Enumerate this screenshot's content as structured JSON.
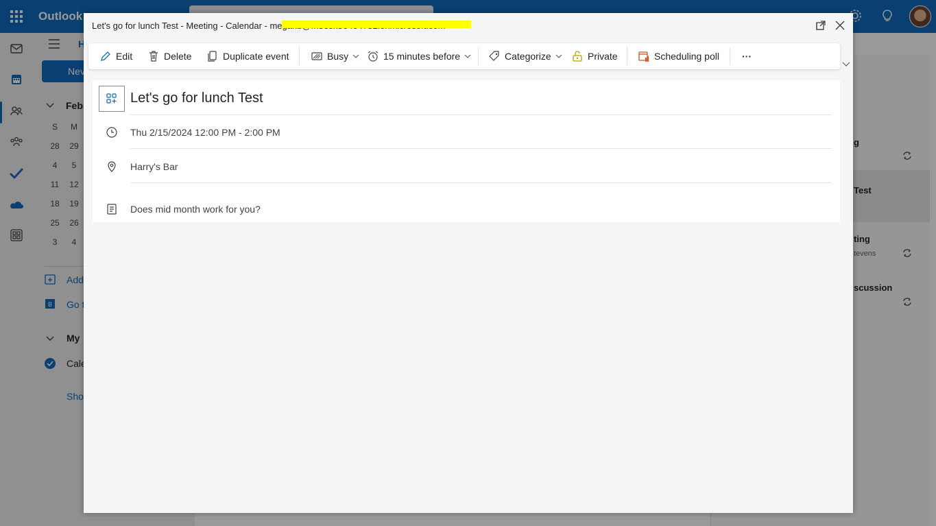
{
  "app": {
    "brand": "Outlook",
    "home_tab": "H",
    "new_button": "Nev",
    "month_label": "Febr",
    "weekday_headers": [
      "S",
      "M"
    ],
    "mini_calendar": [
      [
        "28",
        "29"
      ],
      [
        "4",
        "5"
      ],
      [
        "11",
        "12"
      ],
      [
        "18",
        "19"
      ],
      [
        "25",
        "26"
      ],
      [
        "3",
        "4"
      ]
    ],
    "nav_links": {
      "add_calendar": "Add",
      "go_to": "Go t",
      "my_calendars": "My",
      "calendar_item": "Cale",
      "show_all": "Sho"
    },
    "right_panel_items": [
      {
        "title": "g",
        "sub": ""
      },
      {
        "title": "Test",
        "sub": ""
      },
      {
        "title": "ting",
        "sub": "tevens"
      },
      {
        "title": "scussion",
        "sub": ""
      }
    ]
  },
  "dialog": {
    "window_title": "Let's go for lunch Test - Meeting - Calendar - meganb@m365x86464731.onmicrosoft.com",
    "toolbar": {
      "edit": "Edit",
      "delete": "Delete",
      "duplicate": "Duplicate event",
      "busy": "Busy",
      "reminder": "15 minutes before",
      "categorize": "Categorize",
      "private": "Private",
      "scheduling_poll": "Scheduling poll",
      "more": "···"
    },
    "event": {
      "title": "Let's go for lunch Test",
      "datetime": "Thu 2/15/2024 12:00 PM - 2:00 PM",
      "location": "Harry's Bar",
      "body": "Does mid month work for you?"
    }
  },
  "colors": {
    "brand_blue": "#0f6cbd",
    "highlight": "#ffff00",
    "poll_orange": "#d74e1b"
  },
  "icons": [
    "waffle-icon",
    "mail-icon",
    "calendar-icon",
    "people-icon",
    "groups-icon",
    "todo-icon",
    "onedrive-icon",
    "apps-icon",
    "pencil-icon",
    "trash-icon",
    "copy-icon",
    "busy-icon",
    "alarm-icon",
    "tag-icon",
    "lock-icon",
    "poll-icon",
    "clock-icon",
    "location-icon",
    "notes-icon",
    "popout-icon",
    "close-icon"
  ]
}
